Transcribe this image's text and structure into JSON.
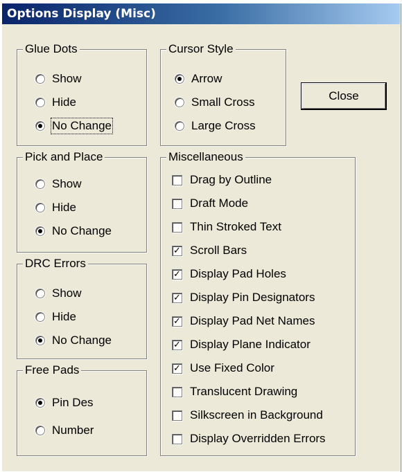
{
  "window": {
    "title": "Options Display (Misc)"
  },
  "groups": {
    "glue_dots": {
      "title": "Glue Dots",
      "options": [
        {
          "label": "Show",
          "checked": false
        },
        {
          "label": "Hide",
          "checked": false
        },
        {
          "label": "No Change",
          "checked": true
        }
      ]
    },
    "pick_and_place": {
      "title": "Pick and Place",
      "options": [
        {
          "label": "Show",
          "checked": false
        },
        {
          "label": "Hide",
          "checked": false
        },
        {
          "label": "No Change",
          "checked": true
        }
      ]
    },
    "drc_errors": {
      "title": "DRC Errors",
      "options": [
        {
          "label": "Show",
          "checked": false
        },
        {
          "label": "Hide",
          "checked": false
        },
        {
          "label": "No Change",
          "checked": true
        }
      ]
    },
    "free_pads": {
      "title": "Free Pads",
      "options": [
        {
          "label": "Pin Des",
          "checked": true
        },
        {
          "label": "Number",
          "checked": false
        }
      ]
    },
    "cursor_style": {
      "title": "Cursor Style",
      "options": [
        {
          "label": "Arrow",
          "checked": true
        },
        {
          "label": "Small Cross",
          "checked": false
        },
        {
          "label": "Large Cross",
          "checked": false
        }
      ]
    },
    "misc": {
      "title": "Miscellaneous",
      "options": [
        {
          "label": "Drag by Outline",
          "checked": false
        },
        {
          "label": "Draft Mode",
          "checked": false
        },
        {
          "label": "Thin Stroked Text",
          "checked": false
        },
        {
          "label": "Scroll Bars",
          "checked": true
        },
        {
          "label": "Display Pad Holes",
          "checked": true
        },
        {
          "label": "Display Pin Designators",
          "checked": true
        },
        {
          "label": "Display Pad Net Names",
          "checked": true
        },
        {
          "label": "Display Plane Indicator",
          "checked": true
        },
        {
          "label": "Use Fixed Color",
          "checked": true
        },
        {
          "label": "Translucent Drawing",
          "checked": false
        },
        {
          "label": "Silkscreen in Background",
          "checked": false
        },
        {
          "label": "Display Overridden Errors",
          "checked": false
        }
      ]
    }
  },
  "buttons": {
    "close_label": "Close"
  },
  "colors": {
    "face": "#ece9d8",
    "title_start": "#0a246a",
    "title_end": "#a6caf0"
  }
}
